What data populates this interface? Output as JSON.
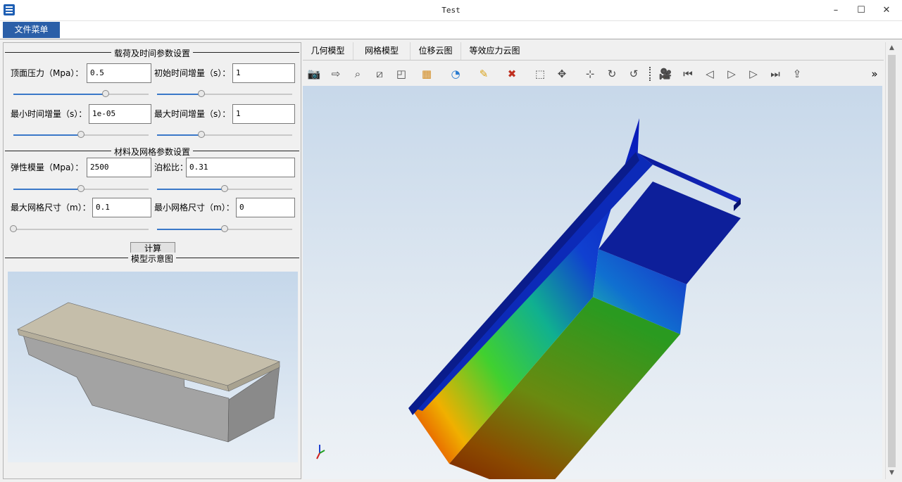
{
  "window": {
    "title": "Test",
    "minimize": "–",
    "maximize": "☐",
    "close": "✕"
  },
  "menu": {
    "file_menu": "文件菜单"
  },
  "load_group": {
    "title": "载荷及时间参数设置",
    "top_pressure": {
      "label": "顶面压力（Mpa）：",
      "value": "0.5",
      "slider": 0.68
    },
    "initial_increment": {
      "label": "初始时间增量（s）：",
      "value": "1",
      "slider": 0.33
    },
    "min_increment": {
      "label": "最小时间增量（s）：",
      "value": "1e-05",
      "slider": 0.5
    },
    "max_increment": {
      "label": "最大时间增量（s）：",
      "value": "1",
      "slider": 0.33
    }
  },
  "material_group": {
    "title": "材料及网格参数设置",
    "elastic_modulus": {
      "label": "弹性模量（Mpa）：",
      "value": "2500",
      "slider": 0.5
    },
    "poisson_ratio": {
      "label": "泊松比：",
      "value": "0.31",
      "slider": 0.5
    },
    "max_mesh_size": {
      "label": "最大网格尺寸（m）：",
      "value": "0.1",
      "slider": 0.0
    },
    "min_mesh_size": {
      "label": "最小网格尺寸（m）：",
      "value": "0",
      "slider": 0.5
    }
  },
  "calculate_button": "计算",
  "model_group": {
    "title": "模型示意图"
  },
  "tabs": [
    "几何模型",
    "网格模型",
    "位移云图",
    "等效应力云图"
  ],
  "toolbar": {
    "more": "»",
    "icons": [
      "camera-icon",
      "export-icon",
      "zoom-icon",
      "fit-box-icon",
      "expand-box-icon",
      "view-cube-icon",
      "light-bulb-icon",
      "brush-icon",
      "ruler-icon",
      "zoom-window-icon",
      "pan-icon",
      "axes-icon",
      "rotate-cw-icon",
      "rotate-ccw-icon",
      "video-camera-icon",
      "first-frame-icon",
      "step-back-icon",
      "play-icon",
      "step-forward-icon",
      "last-frame-icon",
      "share-icon"
    ]
  },
  "colors": {
    "accent": "#2b5fa8",
    "viewport_top": "#c7d8ea",
    "viewport_bottom": "#eef2f6"
  }
}
